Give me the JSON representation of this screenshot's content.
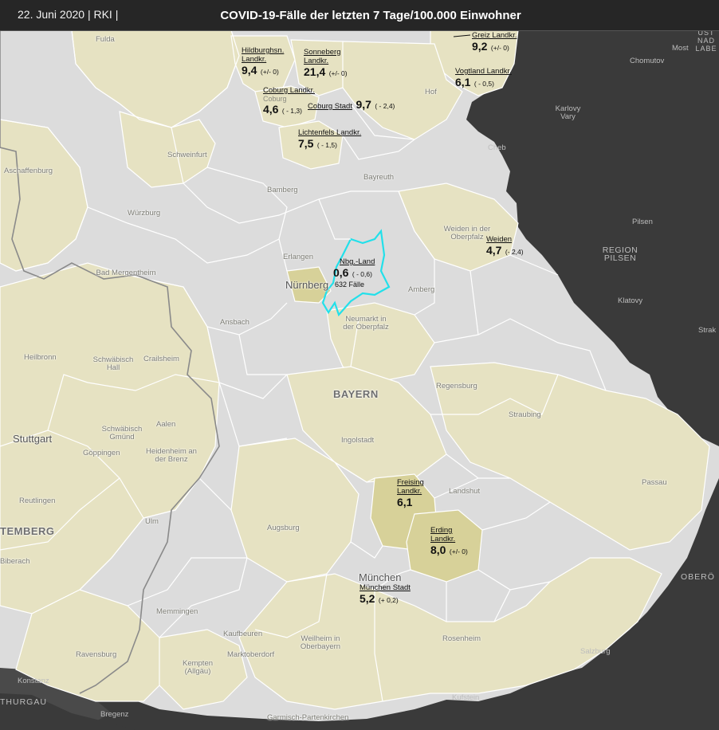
{
  "header": {
    "date_source": "22. Juni 2020  | RKI  |",
    "title": "COVID-19-Fälle der letzten 7 Tage/100.000 Einwohner"
  },
  "colors": {
    "country": "#dcdcdc",
    "highlight": "#e6e2c2",
    "highlight_strong": "#d7d199",
    "outside": "#3a3a3a",
    "border": "#ffffff",
    "state_border": "#8a8a8a",
    "selected_outline": "#22e0ea"
  },
  "place_labels": [
    "Fulda",
    "Hof",
    "Cheb",
    "Schweinfurt",
    "Aschaffenburg",
    "Bamberg",
    "Bayreuth",
    "Würzburg",
    "Bad Mergentheim",
    "Erlangen",
    "Nürnberg",
    "Amberg",
    "Ansbach",
    "Neumarkt in der Oberpfalz",
    "Weiden in der Oberpfalz",
    "Heilbronn",
    "Schwäbisch Hall",
    "Crailsheim",
    "Regensburg",
    "Stuttgart",
    "Schwäbisch Gmünd",
    "Aalen",
    "Göppingen",
    "Heidenheim an der Brenz",
    "Ingolstadt",
    "Straubing",
    "Reutlingen",
    "Ulm",
    "Augsburg",
    "Landshut",
    "Passau",
    "München",
    "Memmingen",
    "Kaufbeuren",
    "Ravensburg",
    "Kempten (Allgäu)",
    "Marktoberdorf",
    "Weilheim in Oberbayern",
    "Rosenheim",
    "Konstanz",
    "Bregenz",
    "Garmisch-Partenkirchen",
    "Kufstein",
    "Salzburg",
    "Biberach"
  ],
  "outside_labels": [
    "Chomutov",
    "Most",
    "Karlovy Vary",
    "Pilsen",
    "REGION PILSEN",
    "Klatovy",
    "Strak",
    "OBERÖ",
    "THURGAU",
    "ÜST NAD LABE"
  ],
  "region_labels": {
    "bayern": "BAYERN",
    "wuerttemberg": "TEMBERG"
  },
  "annotations": [
    {
      "name": "Hildburghsn. Landkr.",
      "value": "9,4",
      "delta": "(+/- 0)"
    },
    {
      "name": "Sonneberg Landkr.",
      "value": "21,4",
      "delta": "(+/- 0)"
    },
    {
      "name": "Greiz Landkr.",
      "value": "9,2",
      "delta": "(+/- 0)"
    },
    {
      "name": "Vogtland Landkr.",
      "value": "6,1",
      "delta": "( - 0,5)"
    },
    {
      "name": "Coburg Landkr.",
      "value": "4,6",
      "delta": "( - 1,3)",
      "place": "Coburg"
    },
    {
      "name": "Coburg Stadt",
      "value": "9,7",
      "delta": "( - 2,4)"
    },
    {
      "name": "Lichtenfels Landkr.",
      "value": "7,5",
      "delta": "( - 1,5)"
    },
    {
      "name": "Weiden",
      "value": "4,7",
      "delta": "(- 2,4)"
    },
    {
      "name": "Nbg.-Land",
      "value": "0,6",
      "delta": "( - 0,6)",
      "extra": "632 Fälle"
    },
    {
      "name": "Freising Landkr.",
      "value": "6,1",
      "delta": ""
    },
    {
      "name": "Erding Landkr.",
      "value": "8,0",
      "delta": "(+/- 0)"
    },
    {
      "name": "München Stadt",
      "value": "5,2",
      "delta": "(+ 0,2)"
    }
  ]
}
